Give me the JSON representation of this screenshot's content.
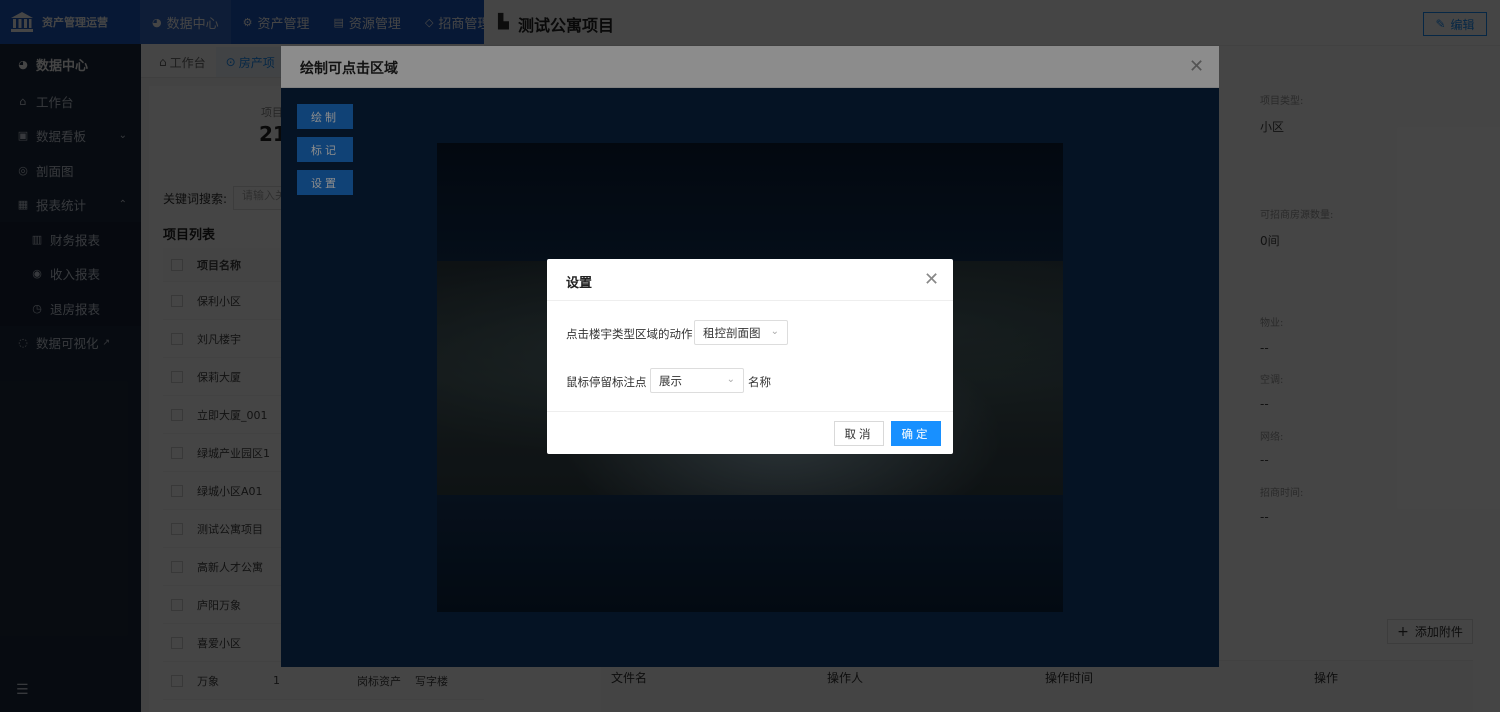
{
  "brand": {
    "title": "资产管理运营"
  },
  "topnav": [
    {
      "label": "数据中心",
      "icon": "chart-pie-icon"
    },
    {
      "label": "资产管理",
      "icon": "settings-icon"
    },
    {
      "label": "资源管理",
      "icon": "document-icon"
    },
    {
      "label": "招商管理",
      "icon": "tag-icon"
    }
  ],
  "sidebar": {
    "head": "数据中心",
    "items": [
      {
        "label": "工作台"
      },
      {
        "label": "数据看板"
      },
      {
        "label": "剖面图"
      },
      {
        "label": "报表统计"
      },
      {
        "label": "财务报表"
      },
      {
        "label": "收入报表"
      },
      {
        "label": "退房报表"
      },
      {
        "label": "数据可视化"
      }
    ]
  },
  "tabs": [
    {
      "label": "工作台"
    },
    {
      "label": "房产项"
    }
  ],
  "stat": {
    "label": "项目",
    "value": "21"
  },
  "search": {
    "label": "关键词搜索:",
    "placeholder": "请输入关"
  },
  "list": {
    "title": "项目列表",
    "header": "项目名称",
    "rows": [
      {
        "name": "保利小区",
        "num": "",
        "extra": ""
      },
      {
        "name": "刘凡楼宇",
        "num": "",
        "extra": ""
      },
      {
        "name": "保莉大厦",
        "num": "",
        "extra": ""
      },
      {
        "name": "立即大厦_001",
        "num": "",
        "extra": ""
      },
      {
        "name": "绿城产业园区1",
        "num": "",
        "extra": ""
      },
      {
        "name": "绿城小区A01",
        "num": "",
        "extra": ""
      },
      {
        "name": "测试公寓项目",
        "num": "",
        "extra": ""
      },
      {
        "name": "高新人才公寓",
        "num": "",
        "extra": ""
      },
      {
        "name": "庐阳万象",
        "num": "",
        "extra": ""
      },
      {
        "name": "喜爱小区",
        "num": "",
        "extra": ""
      },
      {
        "name": "万象",
        "num": "1",
        "extra": "岗标资产"
      }
    ],
    "last_extra2": "写字楼"
  },
  "detail": {
    "title": "测试公寓项目",
    "edit_label": "编辑",
    "fields": [
      {
        "label": "项目类型:",
        "value": "小区"
      },
      {
        "label": "可招商房源数量:",
        "value": "0间"
      },
      {
        "label": "物业:",
        "value": "--"
      },
      {
        "label": "空调:",
        "value": "--"
      },
      {
        "label": "网络:",
        "value": "--"
      },
      {
        "label": "招商时间:",
        "value": "--"
      }
    ],
    "attach_label": "添加附件",
    "file_cols": [
      "文件名",
      "操作人",
      "操作时间",
      "操作"
    ]
  },
  "draw_modal": {
    "title": "绘制可点击区域",
    "tools": [
      "绘制",
      "标记",
      "设置"
    ]
  },
  "settings": {
    "title": "设置",
    "row1_label": "点击楼宇类型区域的动作",
    "row1_value": "租控剖面图",
    "row2_label": "鼠标停留标注点",
    "row2_value": "展示",
    "row2_suffix": "名称",
    "cancel": "取消",
    "ok": "确定"
  }
}
